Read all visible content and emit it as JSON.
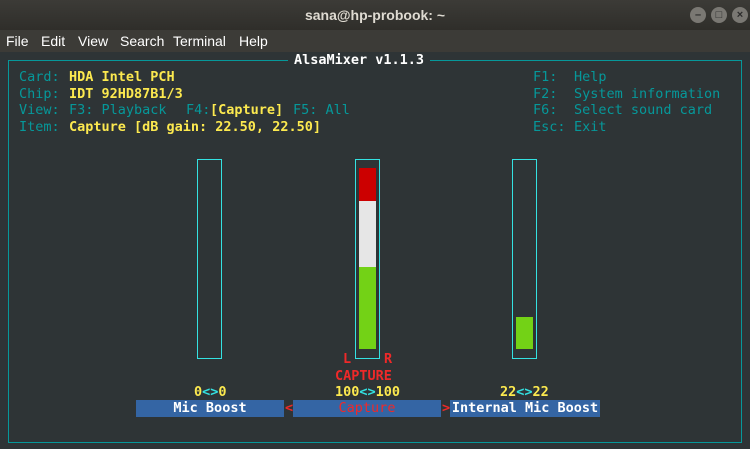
{
  "window": {
    "title": "sana@hp-probook: ~",
    "buttons": [
      "–",
      "□",
      "×"
    ]
  },
  "menubar": [
    "File",
    "Edit",
    "View",
    "Search",
    "Terminal",
    "Help"
  ],
  "alsamixer": {
    "title": "AlsaMixer v1.1.3",
    "info": {
      "card_label": "Card:",
      "card_value": "HDA Intel PCH",
      "chip_label": "Chip:",
      "chip_value": "IDT 92HD87B1/3",
      "view_label": "View:",
      "view_f3": "F3: Playback",
      "view_f4_key": "F4:",
      "view_f4_value": "[Capture]",
      "view_f5": "F5: All",
      "item_label": "Item:",
      "item_value": "Capture [dB gain: 22.50, 22.50]"
    },
    "help": {
      "f1_key": "F1:",
      "f1_label": "Help",
      "f2_key": "F2:",
      "f2_label": "System information",
      "f6_key": "F6:",
      "f6_label": "Select sound card",
      "esc_key": "Esc:",
      "esc_label": "Exit"
    },
    "controls": [
      {
        "name": "Mic Boost",
        "left": "0",
        "sep": "<>",
        "right": "0",
        "level": 0
      },
      {
        "name": "Capture",
        "left": "100",
        "sep": "<>",
        "right": "100",
        "level": 1.0,
        "channels_l": "L",
        "channels_r": "R",
        "capture_label": "CAPTURE",
        "selected_left_arrow": "<",
        "selected_right_arrow": ">"
      },
      {
        "name": "Internal Mic Boost",
        "left": "22",
        "sep": "<>",
        "right": "22",
        "level": 0.18
      }
    ]
  },
  "colors": {
    "terminal_bg": "#2e3436",
    "cyan": "#34e2e2",
    "yellow": "#fce94f",
    "red": "#ef2929",
    "green": "#73d216",
    "white_seg": "#eeeeec",
    "label_bg": "#3465a4"
  }
}
